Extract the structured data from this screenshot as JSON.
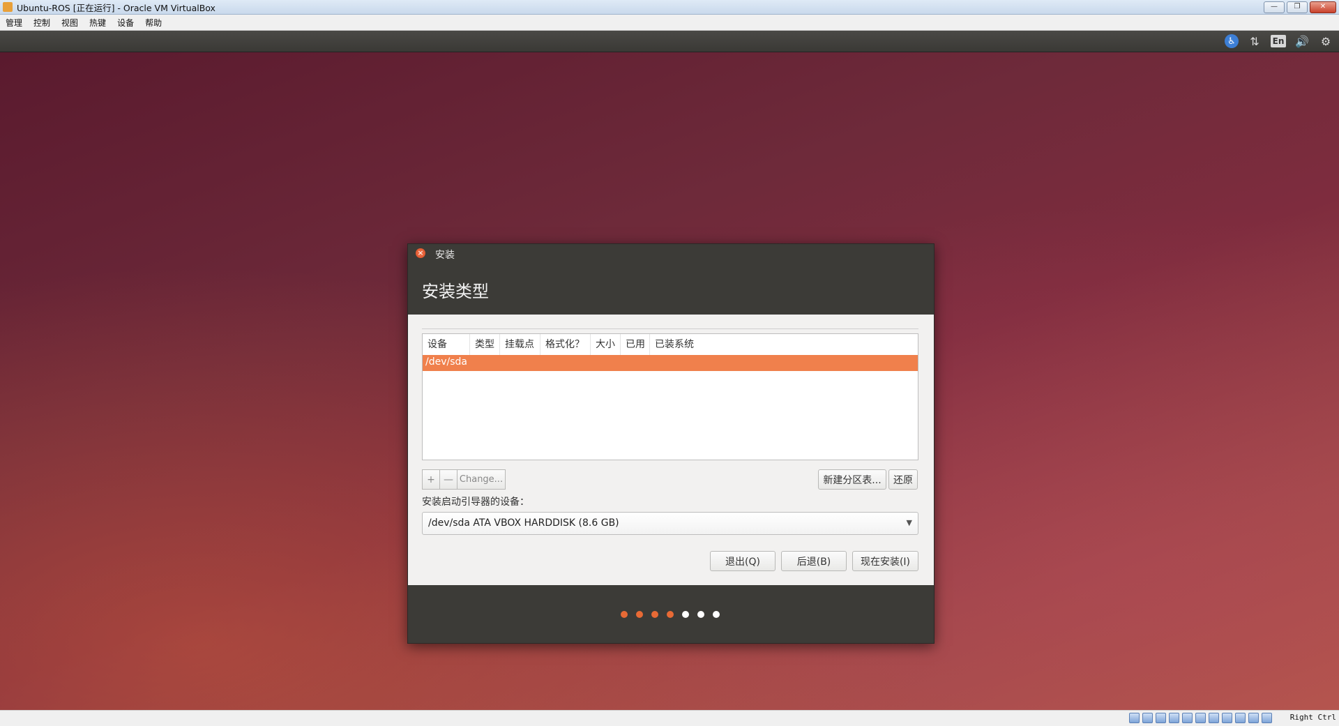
{
  "host_window": {
    "title": "Ubuntu-ROS [正在运行] - Oracle VM VirtualBox",
    "controls": {
      "minimize": "—",
      "restore": "❐",
      "close": "✕"
    }
  },
  "host_menu": [
    "管理",
    "控制",
    "视图",
    "热键",
    "设备",
    "帮助"
  ],
  "guest_panel": {
    "indicators": {
      "accessibility": "♿",
      "network": "⇅",
      "language": "En",
      "sound": "🔊",
      "settings": "⚙"
    }
  },
  "dialog": {
    "window_title": "安装",
    "close_glyph": "×",
    "page_title": "安装类型",
    "table": {
      "columns": [
        "设备",
        "类型",
        "挂载点",
        "格式化？",
        "大小",
        "已用",
        "已装系统"
      ],
      "selected_row": "/dev/sda"
    },
    "tools": {
      "add": "+",
      "remove": "—",
      "change": "Change..."
    },
    "new_partition_table": "新建分区表...",
    "revert": "还原",
    "bootloader_label": "安装启动引导器的设备：",
    "bootloader_value": "/dev/sda  ATA VBOX HARDDISK (8.6 GB)",
    "buttons": {
      "quit": "退出(Q)",
      "back": "后退(B)",
      "install_now": "现在安装(I)"
    },
    "progress": {
      "total_steps": 7,
      "completed_steps": 4,
      "active_color": "#e86a35",
      "inactive_color": "#ffffff"
    }
  },
  "status_bar": {
    "host_key": "Right Ctrl"
  }
}
